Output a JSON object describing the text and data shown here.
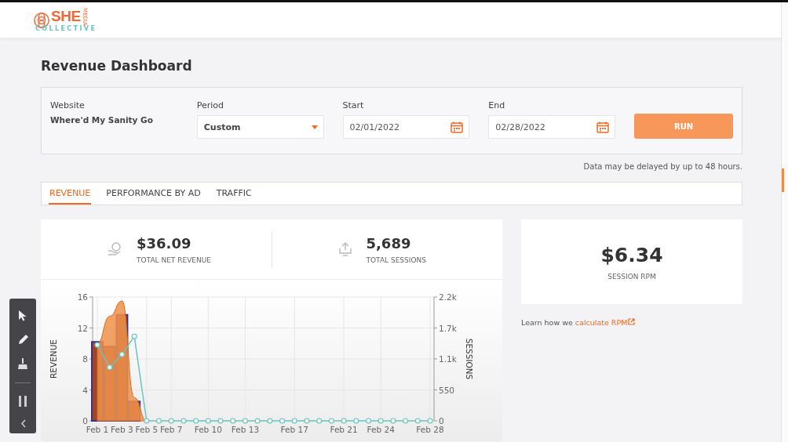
{
  "header": {
    "logo": {
      "mark": "SHE",
      "side": "MEDIA",
      "sub": "COLLECTIVE"
    }
  },
  "page": {
    "title": "Revenue Dashboard"
  },
  "filters": {
    "website": {
      "label": "Website",
      "value": "Where'd My Sanity Go"
    },
    "period": {
      "label": "Period",
      "value": "Custom"
    },
    "start": {
      "label": "Start",
      "value": "02/01/2022"
    },
    "end": {
      "label": "End",
      "value": "02/28/2022"
    },
    "run_button": "RUN"
  },
  "note": "Data may be delayed by up to 48 hours.",
  "tabs": [
    {
      "label": "REVENUE",
      "selected": true
    },
    {
      "label": "PERFORMANCE BY AD",
      "selected": false
    },
    {
      "label": "TRAFFIC",
      "selected": false
    }
  ],
  "stats": [
    {
      "value": "$36.09",
      "label": "TOTAL NET REVENUE",
      "kind": "money"
    },
    {
      "value": "5,689",
      "label": "TOTAL SESSIONS",
      "kind": "sessions"
    }
  ],
  "rpm": {
    "value": "$6.34",
    "label": "SESSION RPM"
  },
  "rpm_link": {
    "text": "Learn how we ",
    "link": "calculate RPM"
  },
  "chart_data": {
    "type": "bar",
    "ylabel": "REVENUE",
    "y2label": "SESSIONS",
    "categories": [
      "Feb 1",
      null,
      "Feb 3",
      null,
      "Feb 5",
      null,
      "Feb 7",
      null,
      null,
      "Feb 10",
      null,
      null,
      "Feb 13",
      null,
      null,
      null,
      "Feb 17",
      null,
      null,
      null,
      "Feb 21",
      null,
      null,
      "Feb 24",
      null,
      null,
      null,
      "Feb 28"
    ],
    "grid": true,
    "ylim": [
      0,
      16
    ],
    "yticks": [
      0,
      4,
      8,
      12,
      16
    ],
    "y2lim": [
      0,
      2200
    ],
    "y2ticks": [
      {
        "value": 0,
        "label": "0"
      },
      {
        "value": 550,
        "label": "550"
      },
      {
        "value": 1100,
        "label": "1.1k"
      },
      {
        "value": 1650,
        "label": "1.7k"
      },
      {
        "value": 2200,
        "label": "2.2k"
      }
    ],
    "series": [
      {
        "color": "#a0442a",
        "values": [
          10.2,
          9.6,
          13.7,
          2.5,
          0,
          0,
          0,
          0,
          0,
          0,
          0,
          0,
          0,
          0,
          0,
          0,
          0,
          0,
          0,
          0,
          0,
          0,
          0,
          0,
          0,
          0,
          0,
          0
        ]
      },
      {
        "type": "area",
        "color": "#f0924a",
        "values": [
          10,
          13.5,
          15.5,
          3,
          0,
          null,
          null,
          null,
          null,
          null,
          null,
          null,
          null,
          null,
          null,
          null,
          null,
          null,
          null,
          null,
          null,
          null,
          null,
          null,
          null,
          null,
          null,
          null
        ]
      },
      {
        "type": "line",
        "axis": "y2",
        "marker": "circle",
        "color": "#6cc4c0",
        "values": [
          1350,
          950,
          1180,
          1500,
          0,
          0,
          0,
          0,
          0,
          0,
          0,
          0,
          0,
          0,
          0,
          0,
          0,
          0,
          0,
          0,
          0,
          0,
          0,
          0,
          0,
          0,
          0,
          0
        ]
      }
    ]
  }
}
